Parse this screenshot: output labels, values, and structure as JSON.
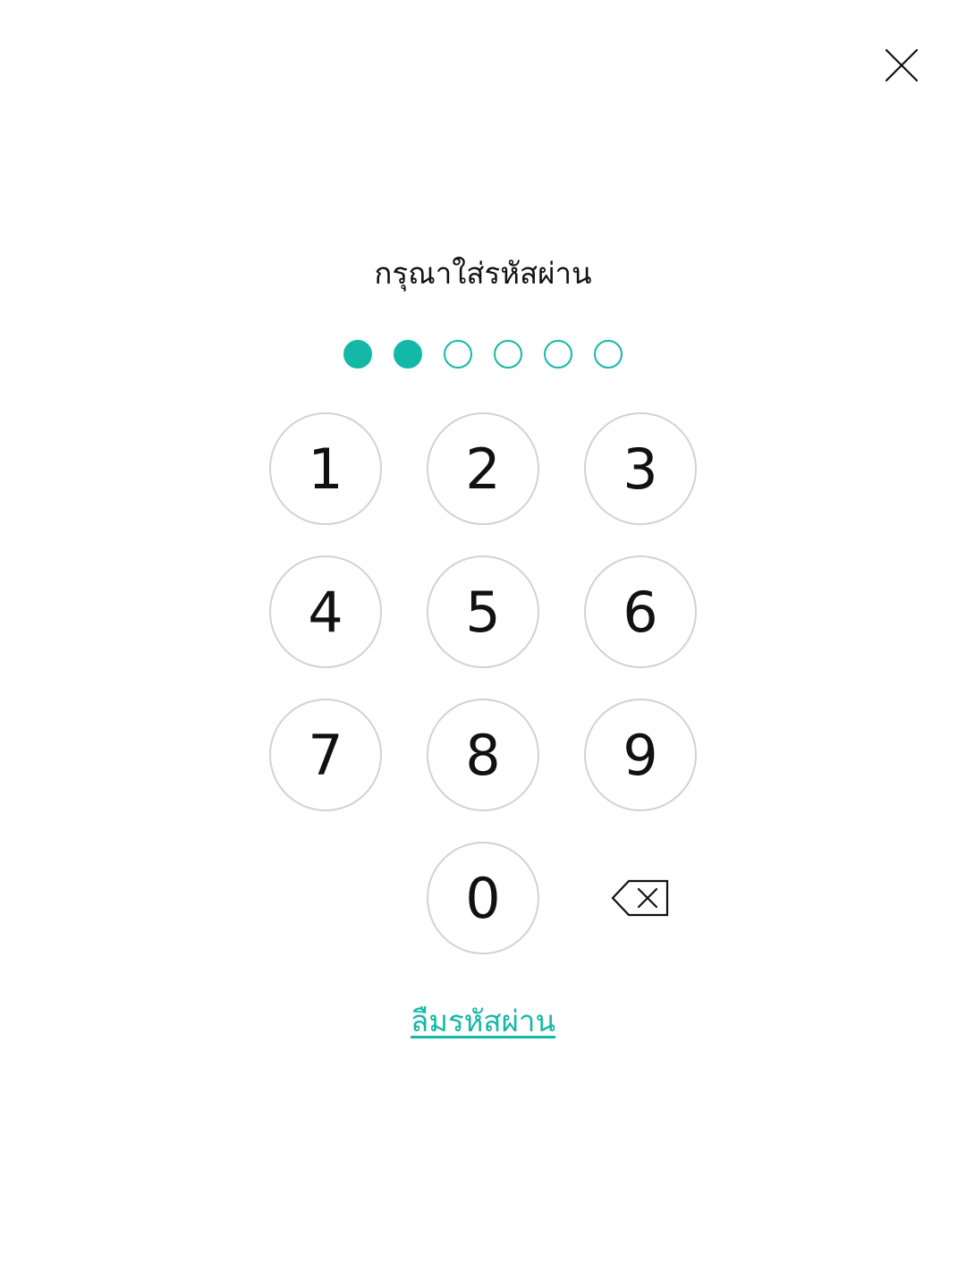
{
  "close": {
    "icon": "close-icon"
  },
  "title": "กรุณาใส่รหัสผ่าน",
  "pin": {
    "length": 6,
    "filled": 2,
    "accent_color": "#14b8a6"
  },
  "keypad": {
    "keys": [
      "1",
      "2",
      "3",
      "4",
      "5",
      "6",
      "7",
      "8",
      "9",
      "0"
    ],
    "backspace_icon": "backspace-icon",
    "border_color": "#d2d2d2"
  },
  "forgot_password": "ลืมรหัสผ่าน"
}
